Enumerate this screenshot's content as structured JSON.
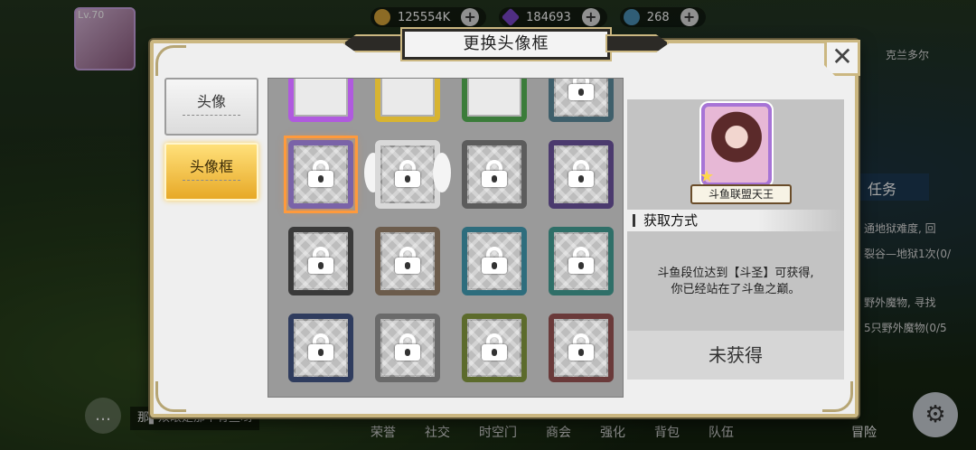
{
  "hud": {
    "level": "Lv.70",
    "gold": "125554K",
    "gem": "184693",
    "energy": "268",
    "plus": "+"
  },
  "side_panel": {
    "location": "克兰多尔",
    "task_label": "任务",
    "lines": [
      "通地狱难度, 回",
      "裂谷—地狱1次(0/",
      "野外魔物, 寻找",
      "5只野外魔物(0/5"
    ]
  },
  "bottom_nav": [
    "荣誉",
    "社交",
    "时空门",
    "商会",
    "强化",
    "背包",
    "队伍",
    "冒险"
  ],
  "chat": {
    "icon": "chat-icon",
    "text": "那▌双眼是那个有些哟"
  },
  "modal": {
    "title": "更换头像框",
    "close": "✕",
    "tabs": [
      {
        "label": "头像",
        "active": false
      },
      {
        "label": "头像框",
        "active": true
      }
    ],
    "frames": [
      {
        "color": "#b05adf",
        "locked": false,
        "selected": false
      },
      {
        "color": "#d8b431",
        "locked": false,
        "selected": false
      },
      {
        "color": "#3b7c3a",
        "locked": false,
        "selected": false
      },
      {
        "color": "#3f5f6b",
        "locked": true,
        "selected": false
      },
      {
        "color": "#7a63a8",
        "locked": true,
        "selected": true
      },
      {
        "color": "#d9d9d9",
        "locked": true,
        "selected": false,
        "wings": true
      },
      {
        "color": "#5c5c5c",
        "locked": true,
        "selected": false
      },
      {
        "color": "#4b3a6e",
        "locked": true,
        "selected": false
      },
      {
        "color": "#3a3a3a",
        "locked": true,
        "selected": false
      },
      {
        "color": "#6c5c4c",
        "locked": true,
        "selected": false
      },
      {
        "color": "#2e6d7d",
        "locked": true,
        "selected": false
      },
      {
        "color": "#2f6f68",
        "locked": true,
        "selected": false
      },
      {
        "color": "#2f3c5e",
        "locked": true,
        "selected": false
      },
      {
        "color": "#6a6a6a",
        "locked": true,
        "selected": false
      },
      {
        "color": "#5c6b2c",
        "locked": true,
        "selected": false
      },
      {
        "color": "#6a3a3a",
        "locked": true,
        "selected": false
      }
    ],
    "detail": {
      "name": "斗鱼联盟天王",
      "section_title": "获取方式",
      "description_1": "斗鱼段位达到【斗圣】可获得,",
      "description_2": "你已经站在了斗鱼之巅。",
      "status": "未获得"
    }
  }
}
